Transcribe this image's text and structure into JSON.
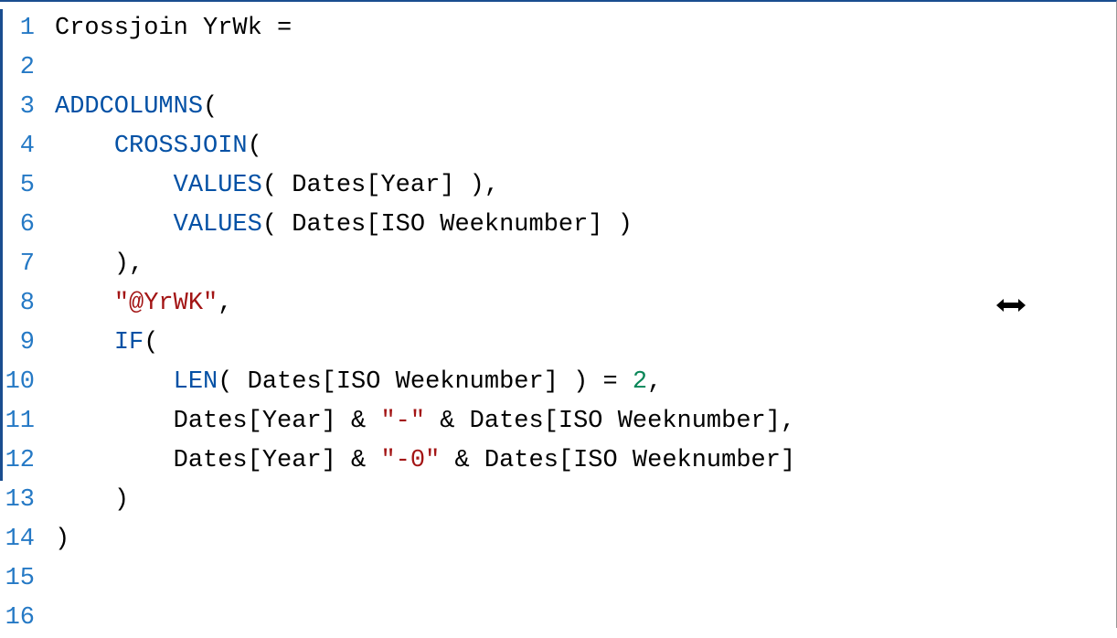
{
  "lines": [
    "1",
    "2",
    "3",
    "4",
    "5",
    "6",
    "7",
    "8",
    "9",
    "10",
    "11",
    "12",
    "13",
    "14",
    "15",
    "16"
  ],
  "code": {
    "l1_name": "Crossjoin YrWk ",
    "l1_eq": "=",
    "l3_fn": "ADDCOLUMNS",
    "l3_p": "(",
    "l4_fn": "CROSSJOIN",
    "l4_p": "(",
    "l5_fn": "VALUES",
    "l5_p1": "( ",
    "l5_col": "Dates[Year]",
    "l5_p2": " ),",
    "l6_fn": "VALUES",
    "l6_p1": "( ",
    "l6_col": "Dates[ISO Weeknumber]",
    "l6_p2": " )",
    "l7": "),",
    "l8_str": "\"@YrWK\"",
    "l8_c": ",",
    "l9_fn": "IF",
    "l9_p": "(",
    "l10_fn": "LEN",
    "l10_p1": "( ",
    "l10_col": "Dates[ISO Weeknumber]",
    "l10_p2": " ) = ",
    "l10_num": "2",
    "l10_c": ",",
    "l11_a": "Dates[Year] & ",
    "l11_s": "\"-\"",
    "l11_b": " & Dates[ISO Weeknumber],",
    "l12_a": "Dates[Year] & ",
    "l12_s": "\"-0\"",
    "l12_b": " & Dates[ISO Weeknumber]",
    "l13": ")",
    "l14": ")"
  },
  "cursor_icon": "⟷"
}
